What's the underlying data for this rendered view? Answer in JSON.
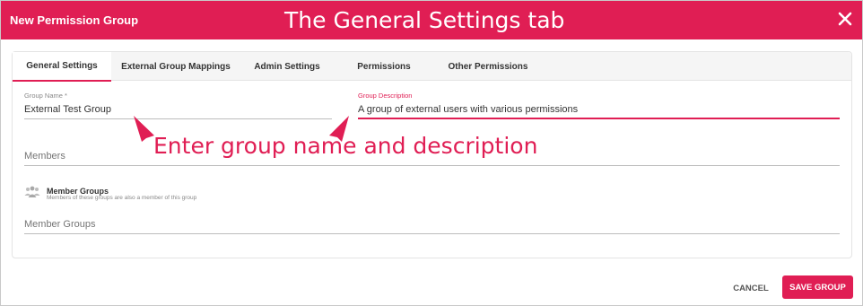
{
  "header": {
    "title": "New Permission Group",
    "annotation": "The General Settings tab",
    "close_icon": "close-icon"
  },
  "tabs": [
    {
      "label": "General Settings",
      "active": true
    },
    {
      "label": "External Group Mappings",
      "active": false
    },
    {
      "label": "Admin Settings",
      "active": false
    },
    {
      "label": "Permissions",
      "active": false
    },
    {
      "label": "Other Permissions",
      "active": false
    }
  ],
  "form": {
    "group_name": {
      "label": "Group Name *",
      "value": "External Test Group"
    },
    "group_description": {
      "label": "Group Description",
      "value": "A group of external users with various permissions"
    },
    "members": {
      "placeholder": "Members"
    },
    "member_groups_section": {
      "title": "Member Groups",
      "description": "Members of these groups are also a member of this group",
      "icon": "group-icon"
    },
    "member_groups": {
      "placeholder": "Member Groups"
    }
  },
  "annotation": {
    "text": "Enter group name and description"
  },
  "footer": {
    "cancel_label": "CANCEL",
    "save_label": "SAVE GROUP"
  },
  "colors": {
    "accent": "#e01e54",
    "header_bg": "#e01e54"
  }
}
